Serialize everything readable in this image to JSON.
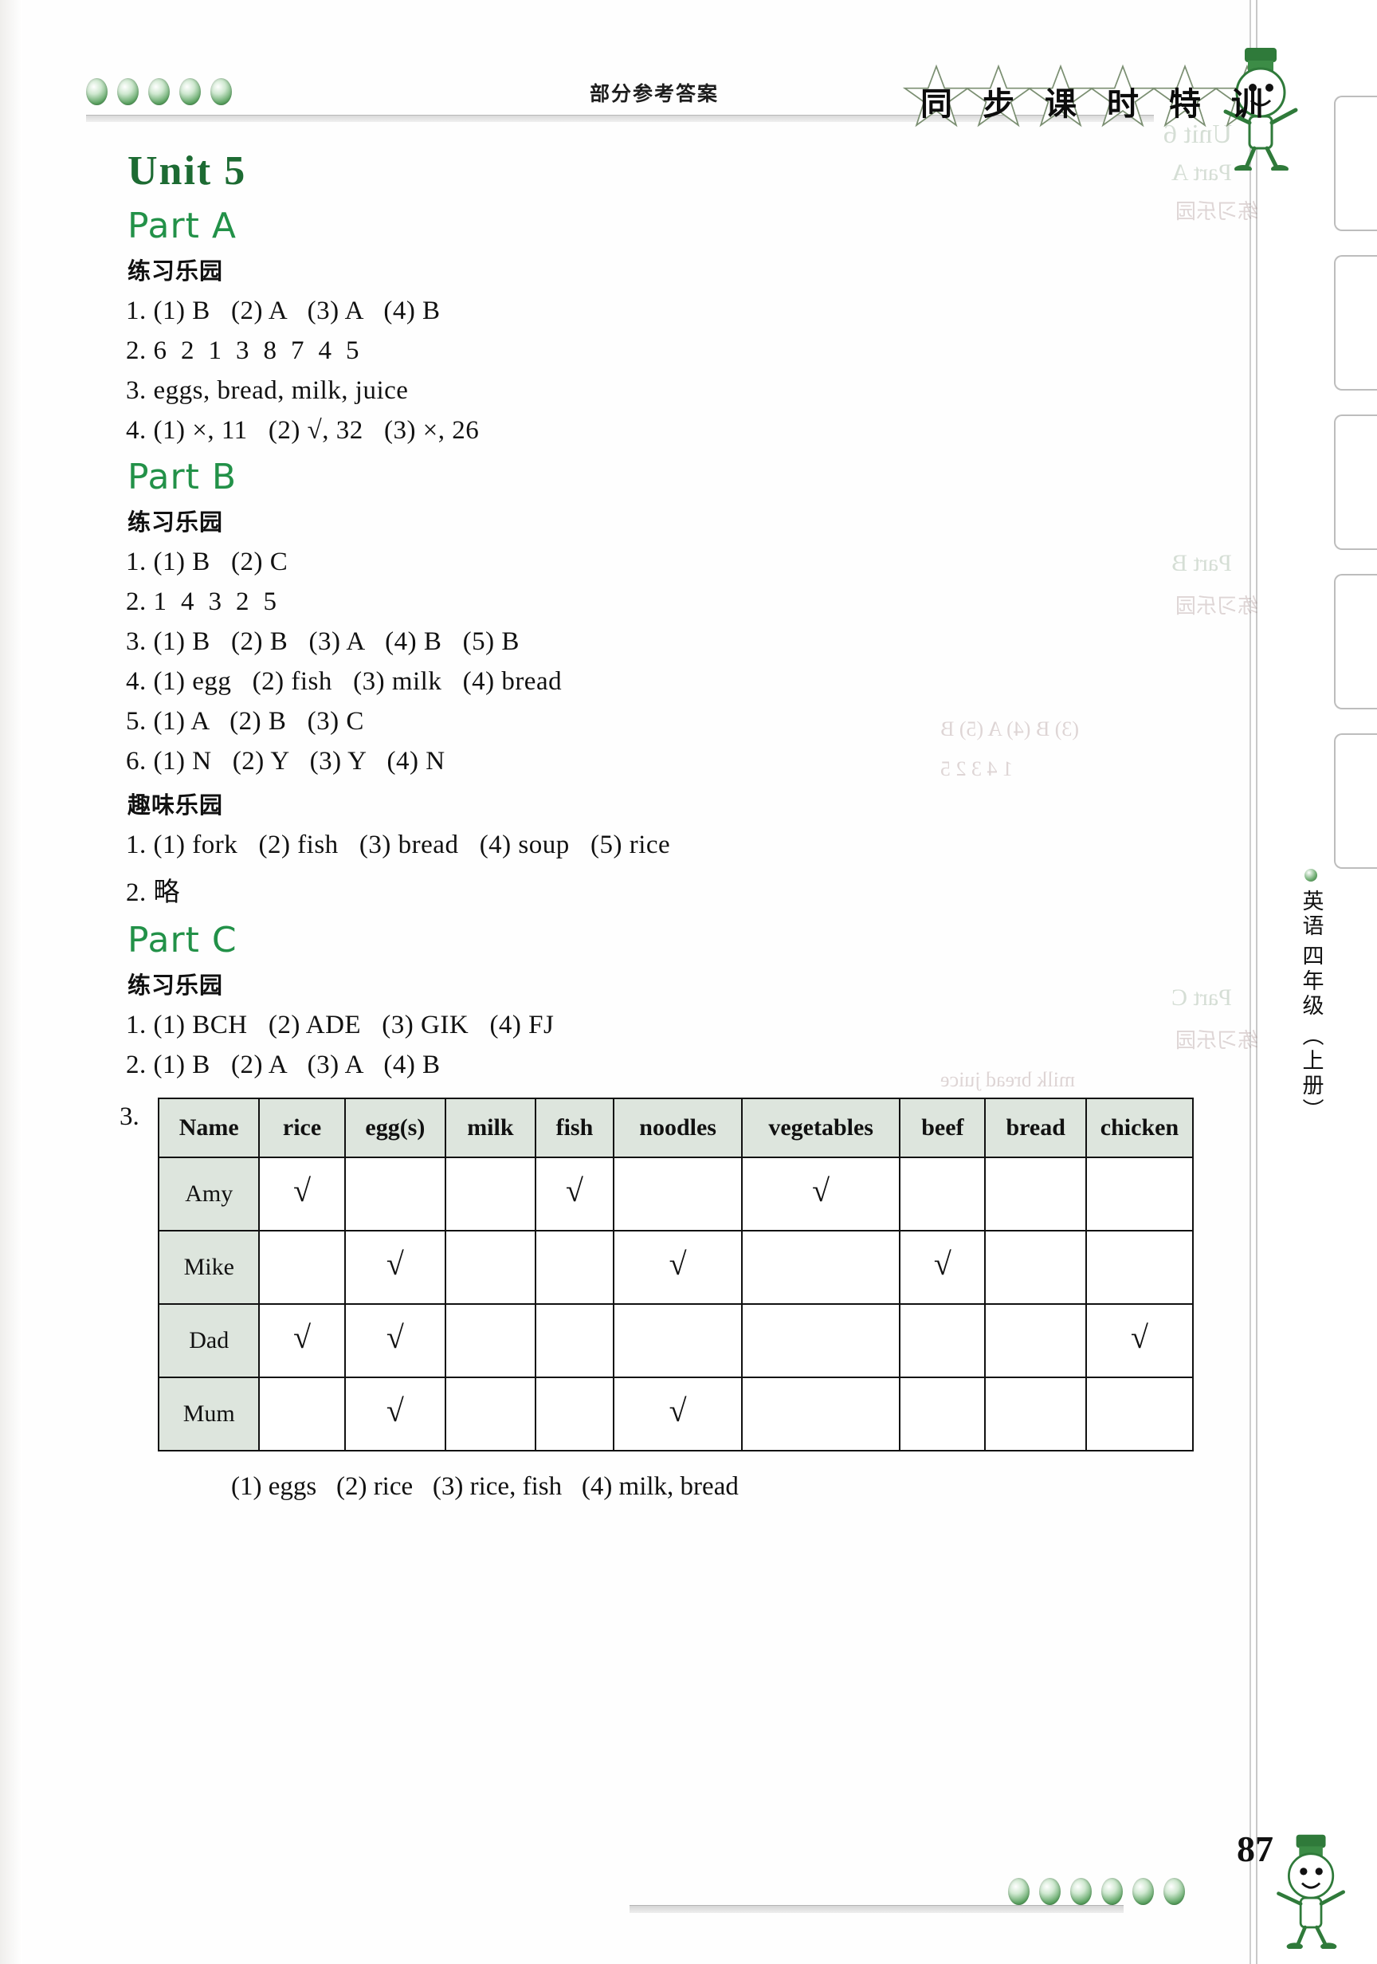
{
  "header": {
    "label": "部分参考答案",
    "star_title": [
      "同",
      "步",
      "课",
      "时",
      "特",
      "训"
    ],
    "dot_count": 5
  },
  "unit": {
    "title": "Unit 5"
  },
  "sections": [
    {
      "part": "Part A",
      "groups": [
        {
          "heading": "练习乐园",
          "lines": [
            "1. (1) B   (2) A   (3) A   (4) B",
            "2. 6  2  1  3  8  7  4  5",
            "3. eggs, bread, milk, juice",
            "4. (1) ×, 11   (2) √, 32   (3) ×, 26"
          ]
        }
      ]
    },
    {
      "part": "Part B",
      "groups": [
        {
          "heading": "练习乐园",
          "lines": [
            "1. (1) B   (2) C",
            "2. 1  4  3  2  5",
            "3. (1) B   (2) B   (3) A   (4) B   (5) B",
            "4. (1) egg   (2) fish   (3) milk   (4) bread",
            "5. (1) A   (2) B   (3) C",
            "6. (1) N   (2) Y   (3) Y   (4) N"
          ]
        },
        {
          "heading": "趣味乐园",
          "lines": [
            "1. (1) fork   (2) fish   (3) bread   (4) soup   (5) rice",
            "2. 略"
          ]
        }
      ]
    },
    {
      "part": "Part C",
      "groups": [
        {
          "heading": "练习乐园",
          "lines": [
            "1. (1) BCH   (2) ADE   (3) GIK   (4) FJ",
            "2. (1) B   (2) A   (3) A   (4) B"
          ]
        }
      ]
    }
  ],
  "question3": {
    "number": "3.",
    "tick": "√",
    "columns": [
      "Name",
      "rice",
      "egg(s)",
      "milk",
      "fish",
      "noodles",
      "vegetables",
      "beef",
      "bread",
      "chicken"
    ],
    "rows": [
      {
        "name": "Amy",
        "marks": [
          true,
          false,
          false,
          true,
          false,
          true,
          false,
          false,
          false
        ]
      },
      {
        "name": "Mike",
        "marks": [
          false,
          true,
          false,
          false,
          true,
          false,
          true,
          false,
          false
        ]
      },
      {
        "name": "Dad",
        "marks": [
          true,
          true,
          false,
          false,
          false,
          false,
          false,
          false,
          true
        ]
      },
      {
        "name": "Mum",
        "marks": [
          false,
          true,
          false,
          false,
          true,
          false,
          false,
          false,
          false
        ]
      }
    ],
    "sub_answers": "(1) eggs   (2) rice   (3) rice, fish   (4) milk, bread"
  },
  "footer": {
    "page_number": "87",
    "dot_count": 6,
    "spine_subject": "英语",
    "spine_grade": "四年级",
    "spine_volume": "（上册）"
  },
  "colors": {
    "heading_green": "#229148",
    "unit_green": "#1d6b33",
    "table_header_bg": "#dde5dd",
    "text": "#111111"
  }
}
